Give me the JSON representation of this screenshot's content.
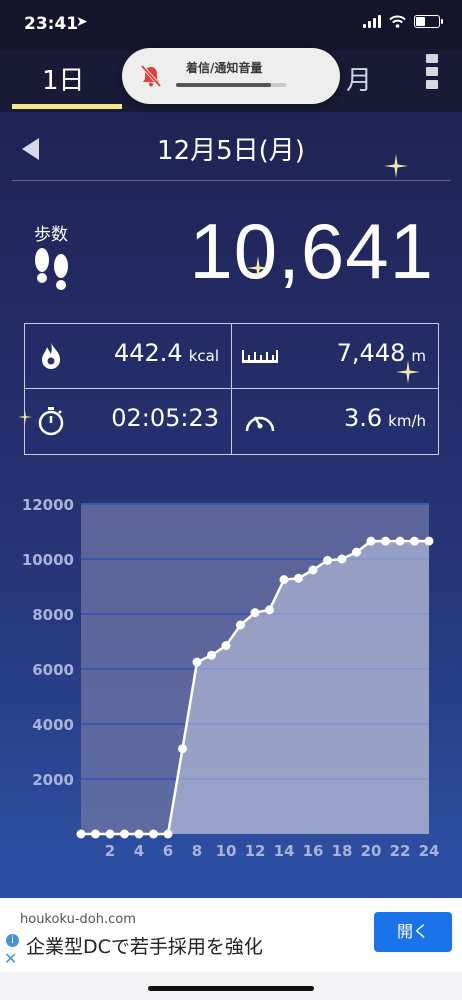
{
  "status_bar": {
    "time": "23:41"
  },
  "tabs": {
    "day": "1日",
    "month": "月"
  },
  "volume_hud": {
    "label": "着信/通知音量",
    "level": 0.86
  },
  "date": {
    "title": "12月5日(月)"
  },
  "steps": {
    "label": "歩数",
    "value": "10,641"
  },
  "stats": {
    "calories": {
      "value": "442.4",
      "unit": "kcal"
    },
    "distance": {
      "value": "7,448",
      "unit": "m"
    },
    "time": {
      "value": "02:05:23"
    },
    "speed": {
      "value": "3.6",
      "unit": "km/h"
    }
  },
  "chart_data": {
    "type": "area",
    "x": [
      0,
      1,
      2,
      3,
      4,
      5,
      6,
      7,
      8,
      9,
      10,
      11,
      12,
      13,
      14,
      15,
      16,
      17,
      18,
      19,
      20,
      21,
      22,
      23,
      24
    ],
    "values": [
      0,
      0,
      0,
      0,
      0,
      0,
      0,
      3100,
      6250,
      6500,
      6850,
      7600,
      8050,
      8150,
      9250,
      9300,
      9600,
      9950,
      10000,
      10250,
      10650,
      10650,
      10650,
      10650,
      10650
    ],
    "y_ticks": [
      "2000",
      "4000",
      "6000",
      "8000",
      "10000",
      "12000"
    ],
    "x_ticks": [
      "2",
      "4",
      "6",
      "8",
      "10",
      "12",
      "14",
      "16",
      "18",
      "20",
      "22",
      "24"
    ],
    "xlim": [
      0,
      24
    ],
    "ylim": [
      0,
      12000
    ],
    "grid": true
  },
  "ad": {
    "domain": "houkoku-doh.com",
    "text": "企業型DCで若手採用を強化",
    "button": "開く"
  }
}
